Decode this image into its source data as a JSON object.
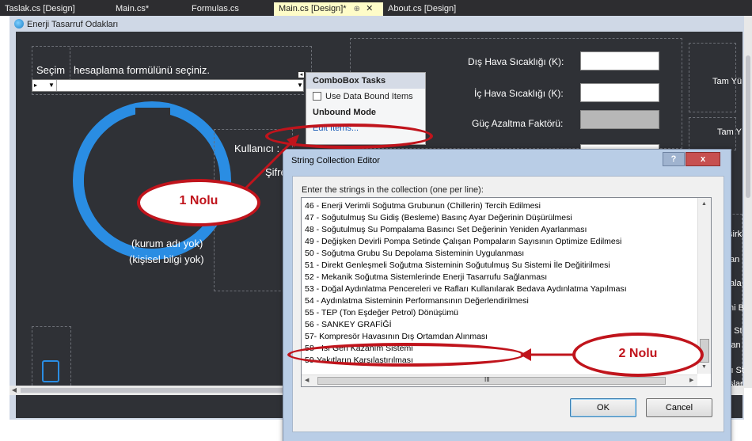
{
  "tabs": [
    {
      "label": "Taslak.cs [Design]"
    },
    {
      "label": "Main.cs*"
    },
    {
      "label": "Formulas.cs"
    },
    {
      "label": "Main.cs [Design]*",
      "active": true,
      "pin": "⊕",
      "close": "✕"
    },
    {
      "label": "About.cs [Design]"
    }
  ],
  "form": {
    "title": "Enerji Tasarruf Odakları"
  },
  "left_panel": {
    "secim_label": "Seçim",
    "formula_label": "hesaplama formülünü seçiniz.",
    "kullanici_label": "Kullanıcı :",
    "sifre_label": "Şifre",
    "kurum": "(kurum adı yok)",
    "kisisel": "(kişisel bilgi yok)"
  },
  "smart_tag": {
    "header": "ComboBox Tasks",
    "use_data_bound": "Use Data Bound Items",
    "unbound_mode": "Unbound Mode",
    "edit_items": "Edit Items..."
  },
  "right_fields": {
    "dis_hava": "Dış Hava Sıcaklığı (K):",
    "ic_hava": "İç Hava Sıcaklığı (K):",
    "guc_azaltma": "Güç Azaltma Faktörü:",
    "tam_yu_1": "Tam Yü",
    "tam_y_2": "Tam Y",
    "side": [
      "şirk",
      "an",
      "ala",
      "hi B",
      "ı St",
      "lan",
      "lı St",
      "slar"
    ]
  },
  "dialog": {
    "title": "String Collection Editor",
    "help": "?",
    "close": "x",
    "instructions": "Enter the strings in the collection (one per line):",
    "items": [
      "46 - Enerji Verimli Soğutma Grubunun (Chillerin) Tercih Edilmesi",
      "47 - Soğutulmuş Su Gidiş (Besleme) Basınç Ayar Değerinin Düşürülmesi",
      "48 - Soğutulmuş Su Pompalama Basıncı Set Değerinin Yeniden Ayarlanması",
      "49 - Değişken Devirli Pompa Setinde Çalışan Pompaların Sayısının Optimize Edilmesi",
      "50 - Soğutma Grubu Su Depolama Sisteminin Uygulanması",
      "51 - Direkt Genleşmeli Soğutma Sisteminin Soğutulmuş Su Sistemi İle Değitirilmesi",
      "52 - Mekanik Soğutma Sistemlerinde Enerji Tasarrufu Sağlanması",
      "53 - Doğal Aydınlatma Pencereleri ve Rafları Kullanılarak Bedava Aydınlatma Yapılması",
      "54 - Aydınlatma Sisteminin Performansının Değerlendirilmesi",
      "55 - TEP (Ton Eşdeğer Petrol) Dönüşümü",
      "56 - SANKEY GRAFİĞİ",
      "57- Kompresör Havasının Dış Ortamdan Alınması",
      "58 - Isı Geri Kazanım Sistemi",
      "59-Yakıtların Karşılaştırılması"
    ],
    "hscroll_label": "III",
    "ok": "OK",
    "cancel": "Cancel"
  },
  "annotations": {
    "callout1": "1 Nolu",
    "callout2": "2 Nolu"
  },
  "colors": {
    "annotation": "#c0141c",
    "form_bg": "#2f3136",
    "globe": "#2a8de3"
  }
}
